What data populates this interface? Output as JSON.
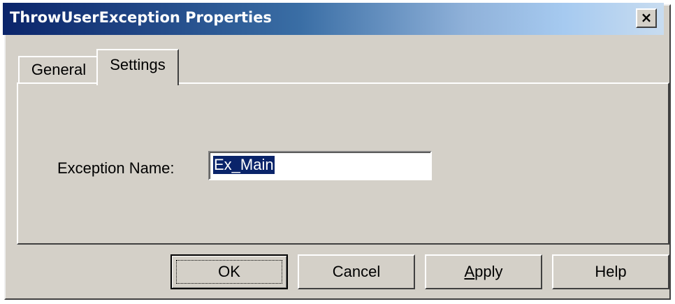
{
  "window": {
    "title": "ThrowUserException Properties",
    "close_glyph": "×"
  },
  "tabs": [
    {
      "label": "General",
      "selected": false
    },
    {
      "label": "Settings",
      "selected": true
    }
  ],
  "settings": {
    "exception_name_label": "Exception Name:",
    "exception_name_value": "Ex_Main",
    "exception_name_selected": true
  },
  "buttons": {
    "ok": "OK",
    "cancel": "Cancel",
    "apply_mnemonic": "A",
    "apply_rest": "pply",
    "help": "Help"
  },
  "colors": {
    "title_bar_start": "#0a246a",
    "title_bar_end": "#a6caf0",
    "dialog_face": "#d4d0c8",
    "selection": "#0a246a"
  },
  "icons": {
    "close": "close-icon"
  }
}
